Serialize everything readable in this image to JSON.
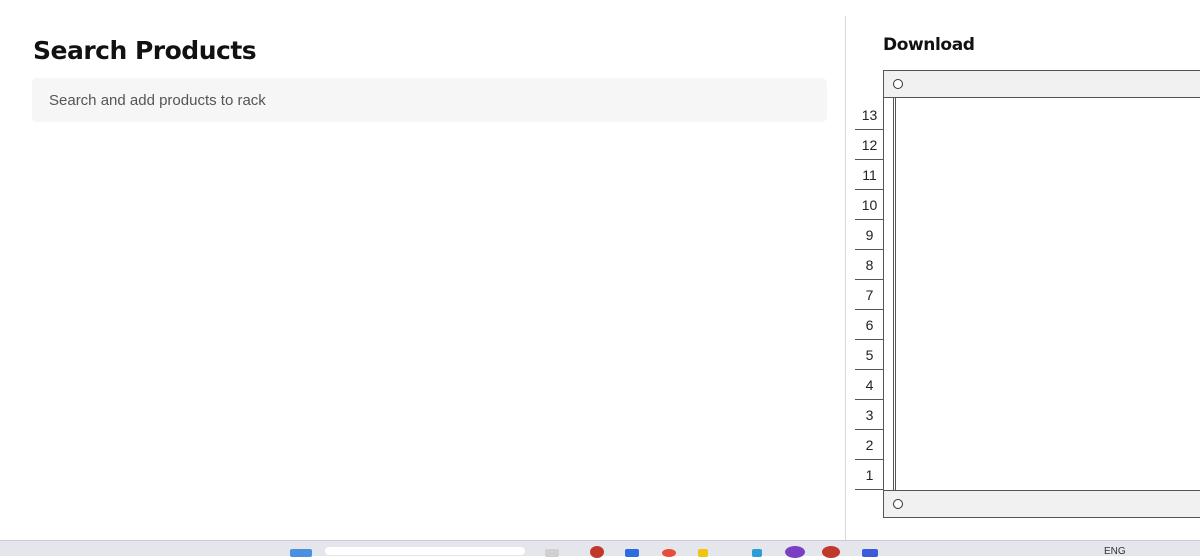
{
  "header": {
    "title": "Search Products"
  },
  "search": {
    "placeholder": "Search and add products to rack",
    "value": ""
  },
  "rack_panel": {
    "download_label": "Download",
    "units": [
      "13",
      "12",
      "11",
      "10",
      "9",
      "8",
      "7",
      "6",
      "5",
      "4",
      "3",
      "2",
      "1"
    ]
  },
  "taskbar": {
    "language": "ENG",
    "icons": [
      "windows-icon",
      "search-bar",
      "file-explorer-icon",
      "edge-icon",
      "chrome-icon",
      "folder-icon",
      "app-icon",
      "teams-icon",
      "app-icon-2",
      "app-icon-3"
    ]
  }
}
